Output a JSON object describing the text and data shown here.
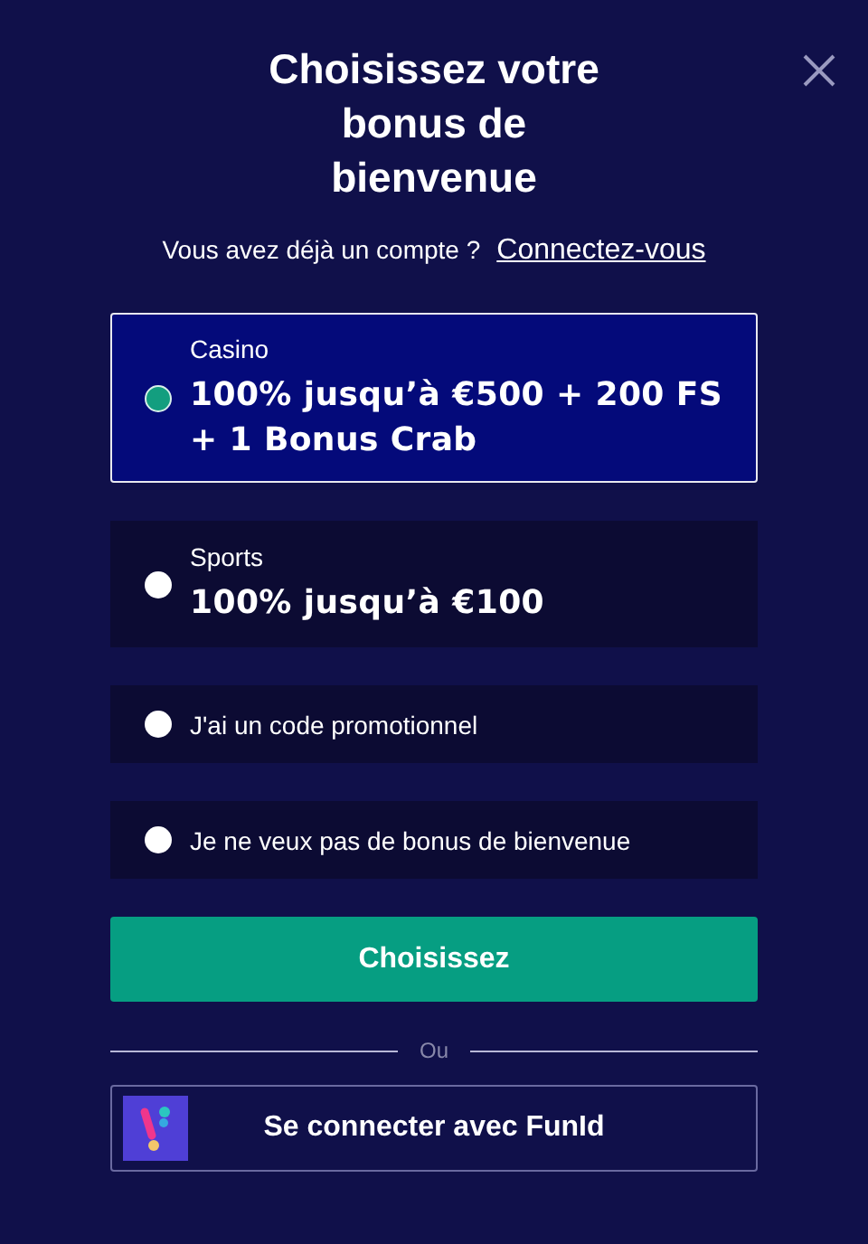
{
  "title": "Choisissez votre bonus de bienvenue",
  "account": {
    "question": "Vous avez déjà un compte ?",
    "link": "Connectez-vous"
  },
  "options": [
    {
      "kind": "bonus",
      "category": "Casino",
      "offer": "100% jusqu’à €500 + 200 FS + 1 Bonus Crab",
      "selected": true
    },
    {
      "kind": "bonus",
      "category": "Sports",
      "offer": "100% jusqu’à €100",
      "selected": false
    },
    {
      "kind": "simple",
      "label": "J'ai un code promotionnel",
      "selected": false
    },
    {
      "kind": "simple",
      "label": "Je ne veux pas de bonus de bienvenue",
      "selected": false
    }
  ],
  "submit": "Choisissez",
  "divider": "Ou",
  "funid": "Se connecter avec FunId"
}
